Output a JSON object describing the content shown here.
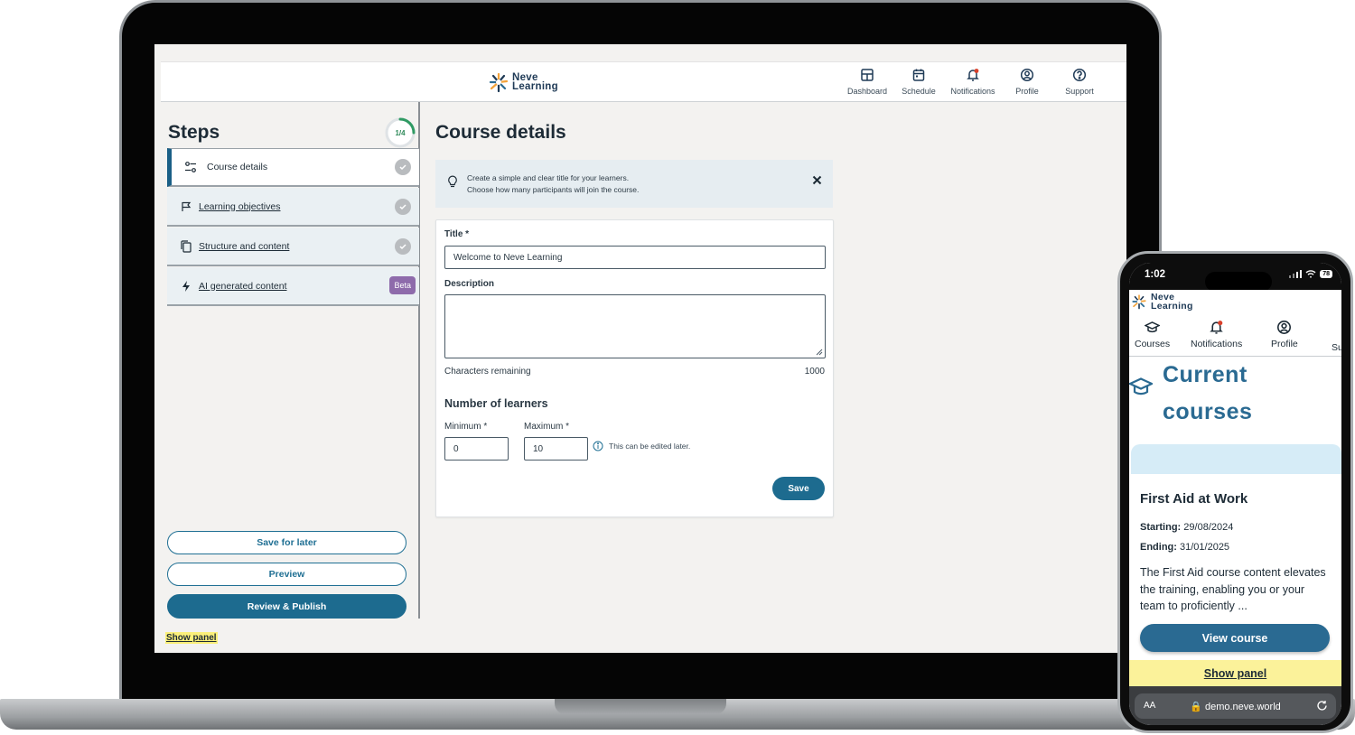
{
  "app": {
    "brand_line1": "Neve",
    "brand_line2": "Learning",
    "accent_color": "#1d6b8f",
    "highlight_color": "#fbf07a"
  },
  "topnav": {
    "items": [
      {
        "label": "Dashboard",
        "icon": "dashboard-icon"
      },
      {
        "label": "Schedule",
        "icon": "calendar-icon"
      },
      {
        "label": "Notifications",
        "icon": "bell-icon"
      },
      {
        "label": "Profile",
        "icon": "user-circle-icon"
      },
      {
        "label": "Support",
        "icon": "help-circle-icon"
      }
    ]
  },
  "steps": {
    "title": "Steps",
    "progress_label": "1/4",
    "progress_fraction": 0.25,
    "items": [
      {
        "label": "Course details",
        "icon": "sliders-icon",
        "status": "active"
      },
      {
        "label": "Learning objectives",
        "icon": "flag-icon",
        "status": "pending"
      },
      {
        "label": "Structure and content",
        "icon": "copy-icon",
        "status": "pending"
      },
      {
        "label": "AI generated content",
        "icon": "lightning-icon",
        "badge": "Beta"
      }
    ],
    "save_for_later": "Save for later",
    "preview": "Preview",
    "review_publish": "Review & Publish",
    "show_panel": "Show panel"
  },
  "main": {
    "title": "Course details",
    "tip_line1": "Create a simple and clear title for your learners.",
    "tip_line2": "Choose how many participants will join the course.",
    "form": {
      "title_label": "Title *",
      "title_value": "Welcome to Neve Learning",
      "description_label": "Description",
      "description_value": "",
      "chars_label": "Characters remaining",
      "chars_value": "1000",
      "learners_heading": "Number of learners",
      "min_label": "Minimum *",
      "min_value": "0",
      "max_label": "Maximum *",
      "max_value": "10",
      "hint": "This can be edited later.",
      "save_label": "Save"
    }
  },
  "phone": {
    "time": "1:02",
    "battery": "78",
    "brand_line1": "Neve",
    "brand_line2": "Learning",
    "nav": [
      {
        "label": "Courses",
        "icon": "graduation-cap-icon"
      },
      {
        "label": "Notifications",
        "icon": "bell-icon"
      },
      {
        "label": "Profile",
        "icon": "user-circle-icon"
      },
      {
        "label": "Su",
        "icon": "help-circle-icon"
      }
    ],
    "heading_line1": "Current",
    "heading_line2": "courses",
    "course": {
      "title": "First Aid at Work",
      "starting_label": "Starting:",
      "starting_value": "29/08/2024",
      "ending_label": "Ending:",
      "ending_value": "31/01/2025",
      "description": "The  First Aid course content elevates the training, enabling you or your team to proficiently ...",
      "view_label": "View course"
    },
    "show_panel": "Show panel",
    "url_aa": "AA",
    "url": "demo.neve.world"
  }
}
